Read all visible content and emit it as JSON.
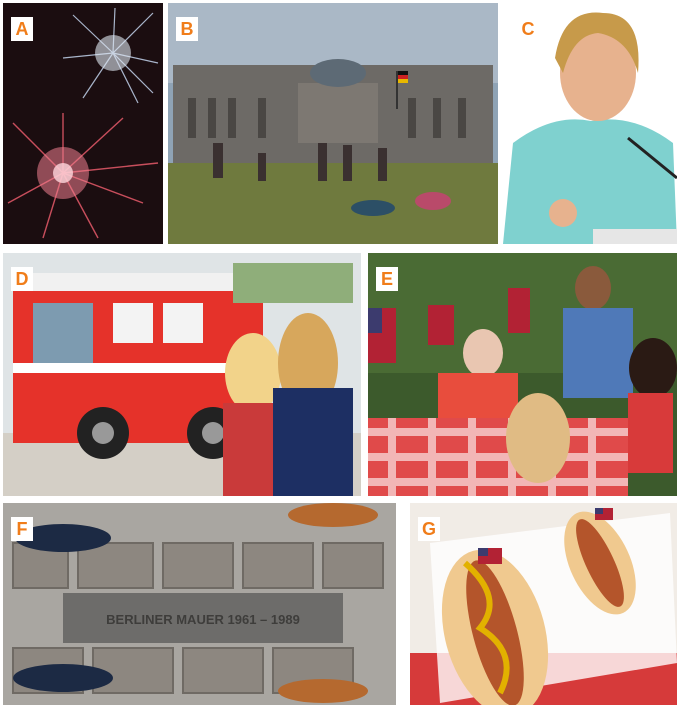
{
  "panels": [
    {
      "label": "A",
      "subject": "fireworks"
    },
    {
      "label": "B",
      "subject": "crowd on lawn in front of parliament building"
    },
    {
      "label": "C",
      "subject": "woman speaking at microphone"
    },
    {
      "label": "D",
      "subject": "children watching fire truck parade"
    },
    {
      "label": "E",
      "subject": "family picnic with flags"
    },
    {
      "label": "F",
      "subject": "cobblestone marker plaque",
      "plaque_text": "BERLINER MAUER 1961 – 1989"
    },
    {
      "label": "G",
      "subject": "hot dogs with mustard and small flags"
    }
  ],
  "colors": {
    "badge_text": "#f07d1a",
    "badge_bg": "#ffffff"
  }
}
